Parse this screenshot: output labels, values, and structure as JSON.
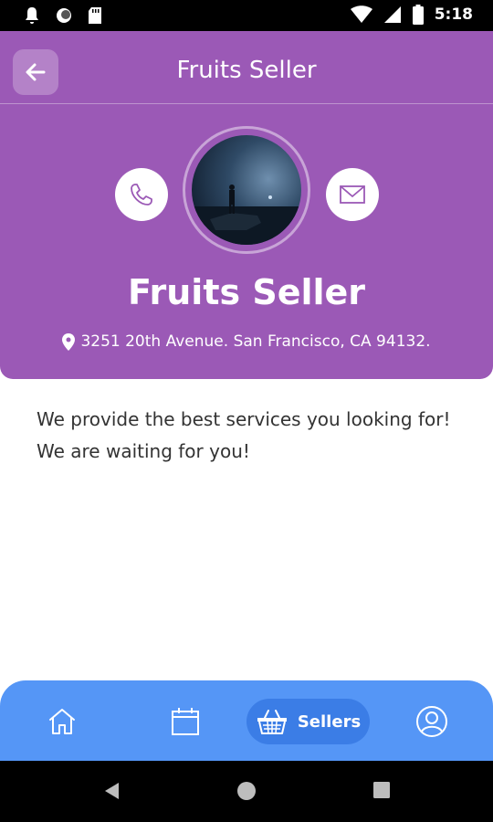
{
  "status_bar": {
    "time": "5:18",
    "icons": [
      "notification-bell-icon",
      "circle-icon",
      "sd-card-icon",
      "wifi-icon",
      "signal-icon",
      "battery-icon"
    ]
  },
  "header": {
    "title": "Fruits Seller",
    "back_icon": "arrow-left-icon",
    "background_color": "#9b59b6"
  },
  "profile": {
    "name": "Fruits Seller",
    "address": "3251 20th Avenue. San Francisco, CA 94132.",
    "call_icon": "phone-icon",
    "mail_icon": "envelope-icon",
    "location_icon": "location-pin-icon"
  },
  "description": "We provide the best services you looking for! We are waiting for you!",
  "bottom_nav": {
    "background_color": "#5596f6",
    "items": [
      {
        "icon": "home-icon",
        "label": ""
      },
      {
        "icon": "calendar-icon",
        "label": ""
      },
      {
        "icon": "basket-icon",
        "label": "Sellers",
        "active": true
      },
      {
        "icon": "user-icon",
        "label": ""
      }
    ]
  },
  "system_nav": [
    "back-triangle-icon",
    "home-circle-icon",
    "recents-square-icon"
  ]
}
